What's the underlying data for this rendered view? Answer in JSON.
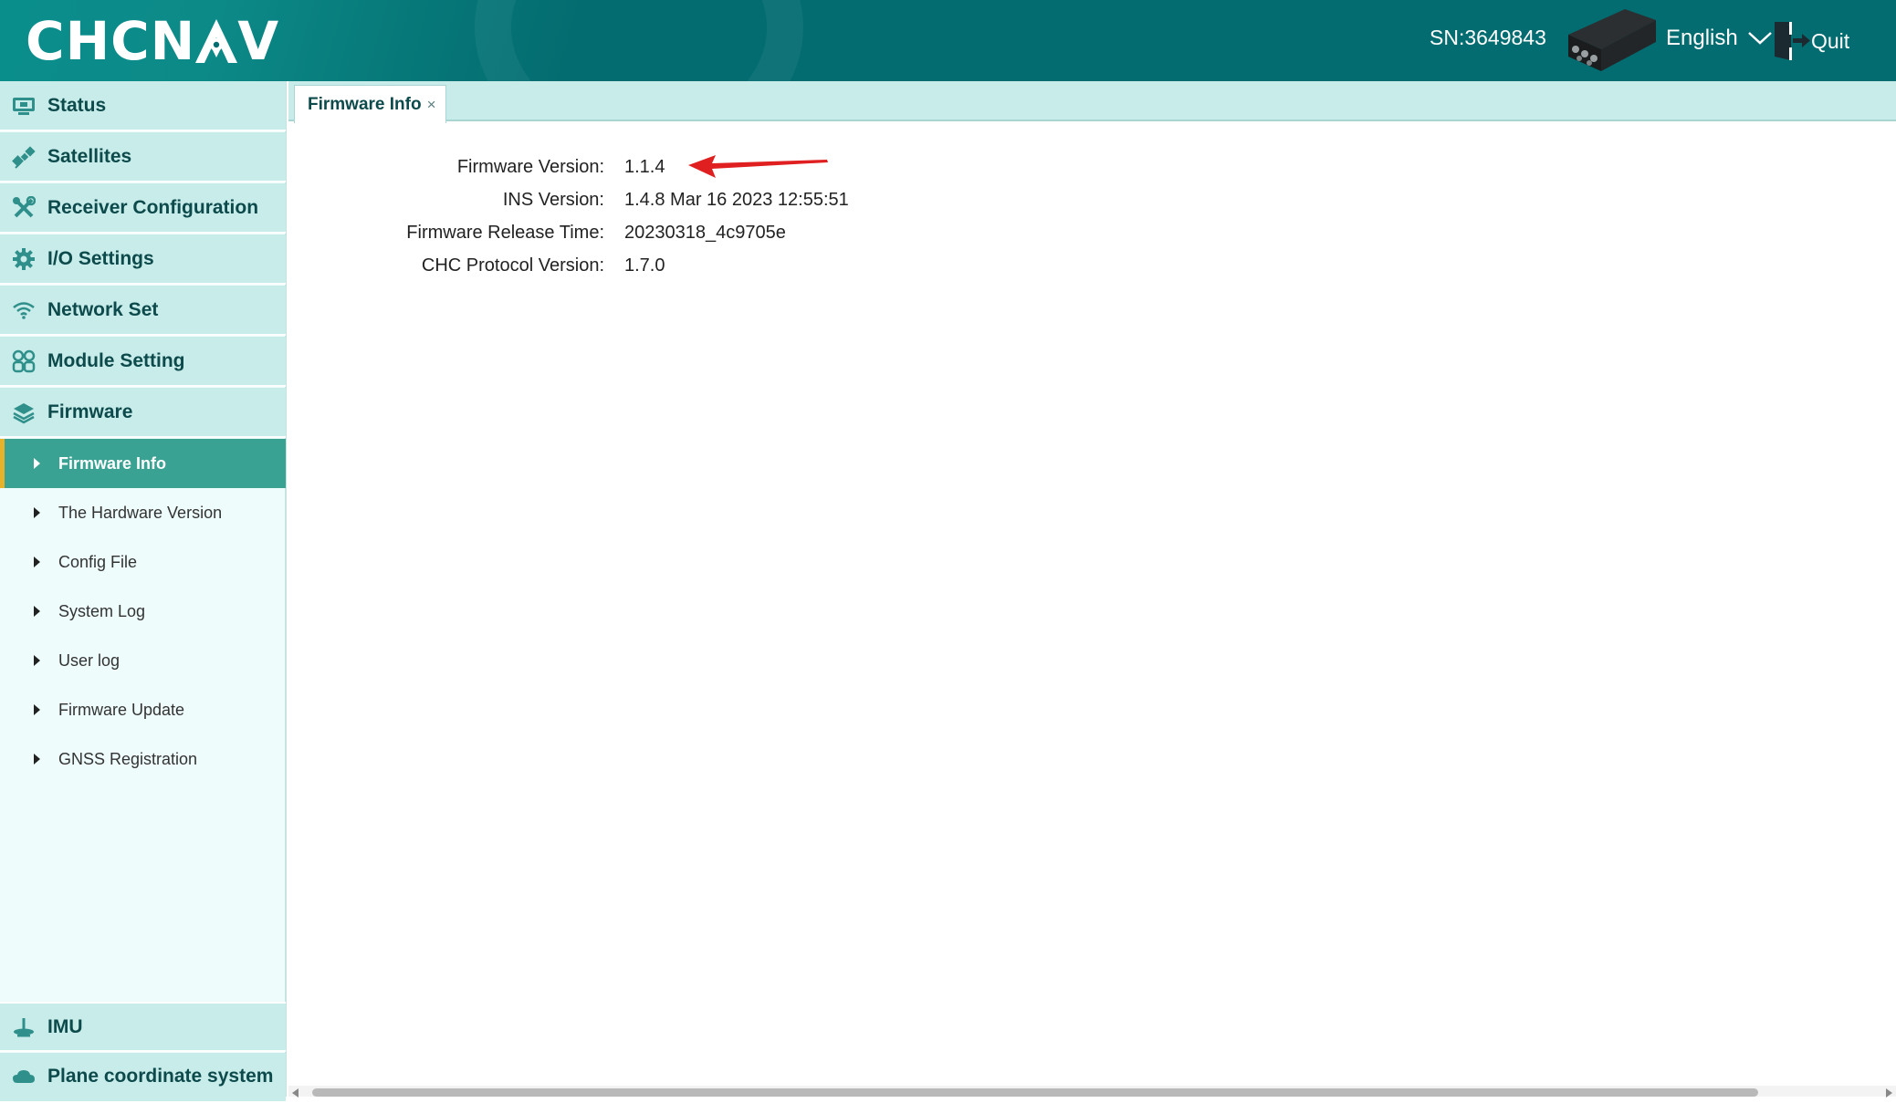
{
  "header": {
    "logo_left": "CHCN",
    "logo_right": "V",
    "sn": "SN:3649843",
    "language": "English",
    "quit_label": "Quit"
  },
  "sidebar": {
    "items_top": [
      {
        "label": "Status",
        "icon": "monitor-icon"
      },
      {
        "label": "Satellites",
        "icon": "satellite-icon"
      },
      {
        "label": "Receiver Configuration",
        "icon": "tools-icon"
      },
      {
        "label": "I/O Settings",
        "icon": "gear-icon"
      },
      {
        "label": "Network Set",
        "icon": "wifi-icon"
      },
      {
        "label": "Module Setting",
        "icon": "modules-icon"
      },
      {
        "label": "Firmware",
        "icon": "layers-icon"
      }
    ],
    "firmware_sub": [
      {
        "label": "Firmware Info",
        "active": true
      },
      {
        "label": "The Hardware Version"
      },
      {
        "label": "Config File"
      },
      {
        "label": "System Log"
      },
      {
        "label": "User log"
      },
      {
        "label": "Firmware Update"
      },
      {
        "label": "GNSS Registration"
      }
    ],
    "items_bottom": [
      {
        "label": "IMU",
        "icon": "imu-icon"
      },
      {
        "label": "Plane coordinate system",
        "icon": "cloud-icon"
      }
    ]
  },
  "tabs": [
    {
      "label": "Firmware Info",
      "close": "×"
    }
  ],
  "firmware_info": [
    {
      "key": "Firmware Version:",
      "value": "1.1.4"
    },
    {
      "key": "INS Version:",
      "value": "1.4.8 Mar 16 2023 12:55:51"
    },
    {
      "key": "Firmware Release Time:",
      "value": "20230318_4c9705e"
    },
    {
      "key": "CHC Protocol Version:",
      "value": "1.7.0"
    }
  ],
  "colors": {
    "header_bg": "#036c70",
    "nav_bg": "#c8ecea",
    "active_bg": "#3aa293",
    "active_bar": "#e8b12a",
    "annotation_arrow": "#e02020"
  }
}
